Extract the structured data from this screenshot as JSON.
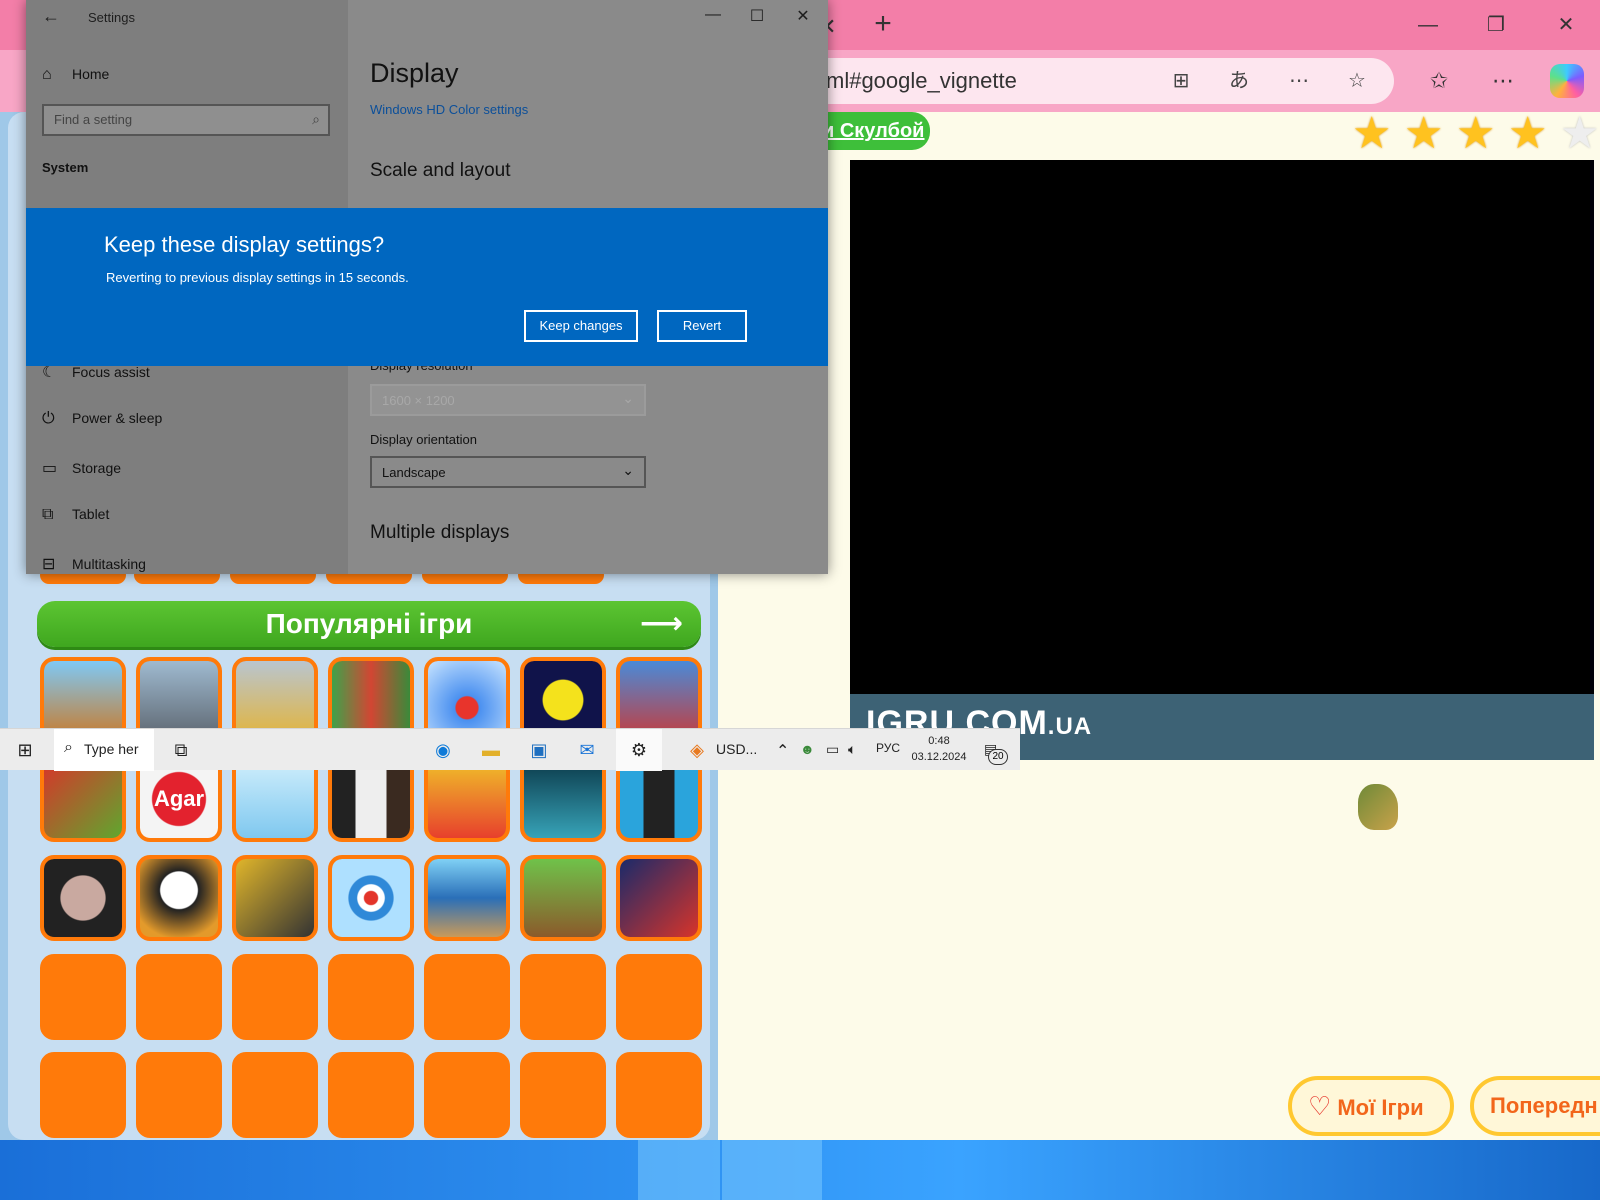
{
  "browser": {
    "address": "ml#google_vignette",
    "site_link": "и Скулбой",
    "rating_stars": 5,
    "video_brand": "IGRU.COM",
    "video_brand_suffix": ".UA",
    "my_games_label": "Мої Ігри",
    "previous_label": "Попередн",
    "colors": {
      "tabbar": "#f37ea8",
      "addrbar": "#f8a6c6",
      "accent_orange": "#ff7a0a",
      "accent_green": "#3ebf3a"
    }
  },
  "games": {
    "popular_title": "Популярні ігри",
    "agar_label": "Agar"
  },
  "settings": {
    "window_title": "Settings",
    "home": "Home",
    "search_placeholder": "Find a setting",
    "system_header": "System",
    "page_title": "Display",
    "hd_color_link": "Windows HD Color settings",
    "scale_layout": "Scale and layout",
    "resolution_label": "Display resolution",
    "resolution_value": "1600 × 1200",
    "orientation_label": "Display orientation",
    "orientation_value": "Landscape",
    "multiple_displays": "Multiple displays",
    "nav": [
      {
        "label": "Focus assist",
        "icon": "moon-icon"
      },
      {
        "label": "Power & sleep",
        "icon": "power-icon"
      },
      {
        "label": "Storage",
        "icon": "storage-icon"
      },
      {
        "label": "Tablet",
        "icon": "tablet-icon"
      },
      {
        "label": "Multitasking",
        "icon": "multitasking-icon"
      }
    ]
  },
  "dialog": {
    "question": "Keep these display settings?",
    "message": "Reverting to previous display settings in 15 seconds.",
    "keep_label": "Keep changes",
    "revert_label": "Revert"
  },
  "taskbar": {
    "search_text": "Type her",
    "app_label": "USD...",
    "language": "РУС",
    "time": "0:48",
    "date": "03.12.2024",
    "notification_count": "20"
  }
}
